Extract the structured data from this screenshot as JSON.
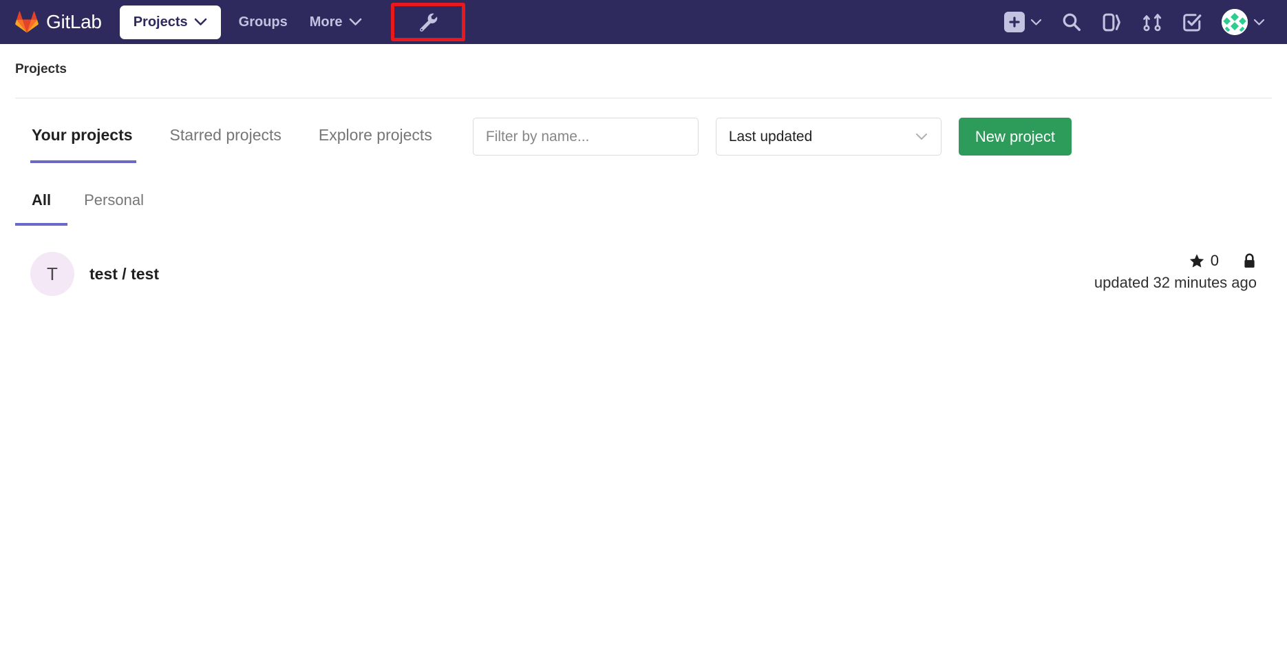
{
  "navbar": {
    "brand": {
      "name": "GitLab",
      "logo_icon": "gitlab-tanuki-logo"
    },
    "items": [
      {
        "label": "Projects",
        "icon": "chevron-down-icon",
        "active": true
      },
      {
        "label": "Groups",
        "icon": "",
        "active": false
      },
      {
        "label": "More",
        "icon": "chevron-down-icon",
        "active": false
      }
    ],
    "admin_tool": {
      "icon": "wrench-icon",
      "highlighted": true,
      "highlight_color": "#e8191c"
    },
    "right_icons": [
      {
        "name": "plus-icon",
        "has_caret": true
      },
      {
        "name": "search-icon",
        "has_caret": false
      },
      {
        "name": "issues-icon",
        "has_caret": false
      },
      {
        "name": "merge-requests-icon",
        "has_caret": false
      },
      {
        "name": "todos-icon",
        "has_caret": false
      },
      {
        "name": "avatar",
        "has_caret": true
      }
    ],
    "background_color": "#2e2a5d",
    "text_color": "#c3c2e0"
  },
  "page": {
    "title": "Projects"
  },
  "tabs": [
    {
      "label": "Your projects",
      "active": true
    },
    {
      "label": "Starred projects",
      "active": false
    },
    {
      "label": "Explore projects",
      "active": false
    }
  ],
  "toolbar": {
    "filter": {
      "value": "",
      "placeholder": "Filter by name..."
    },
    "sort": {
      "selected": "Last updated",
      "caret_icon": "chevron-down-icon"
    },
    "new_project_label": "New project",
    "new_project_color": "#2d9c5a"
  },
  "subtabs": [
    {
      "label": "All",
      "active": true
    },
    {
      "label": "Personal",
      "active": false
    }
  ],
  "projects": [
    {
      "avatar_initial": "T",
      "avatar_bg": "#f4e7f6",
      "name": "test / test",
      "star_count": "0",
      "star_icon": "star-icon",
      "visibility_icon": "lock-icon",
      "updated": "updated 32 minutes ago"
    }
  ],
  "accent": {
    "active_tab_underline": "#6b69c8",
    "divider": "#e8e8e8"
  }
}
